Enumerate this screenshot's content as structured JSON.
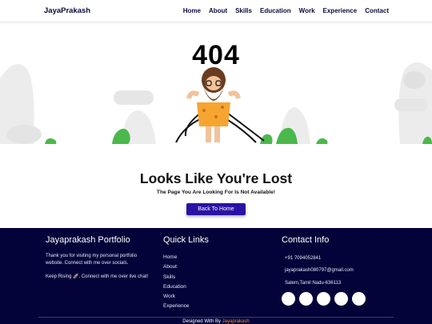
{
  "nav": {
    "brand": "JayaPrakash",
    "items": [
      "Home",
      "About",
      "Skills",
      "Education",
      "Work",
      "Experience",
      "Contact"
    ]
  },
  "error": {
    "code": "404",
    "heading": "Looks Like You're Lost",
    "subheading": "The Page You Are Looking For Is Not Available!",
    "button_label": "Back To Home"
  },
  "footer": {
    "about": {
      "title": "Jayaprakash Portfolio",
      "text1": "Thank you for visiting my personal portfolio website. Connect with me over socials.",
      "text2": "Keep Rising 🚀. Connect with me over live chat!"
    },
    "links": {
      "title": "Quick Links",
      "items": [
        "Home",
        "About",
        "Skills",
        "Education",
        "Work",
        "Experience"
      ]
    },
    "contact": {
      "title": "Contact Info",
      "phone": "+91 7094052841",
      "email": "jayaprakash080797@gmail.com",
      "address": "Salem,Tamil Nadu-636113"
    },
    "credit_prefix": "Designed With  By ",
    "credit_name": "Jayaprakash"
  },
  "colors": {
    "footer_bg": "#03033a",
    "button": "#2b12a6",
    "accent": "#ff8c1a"
  }
}
